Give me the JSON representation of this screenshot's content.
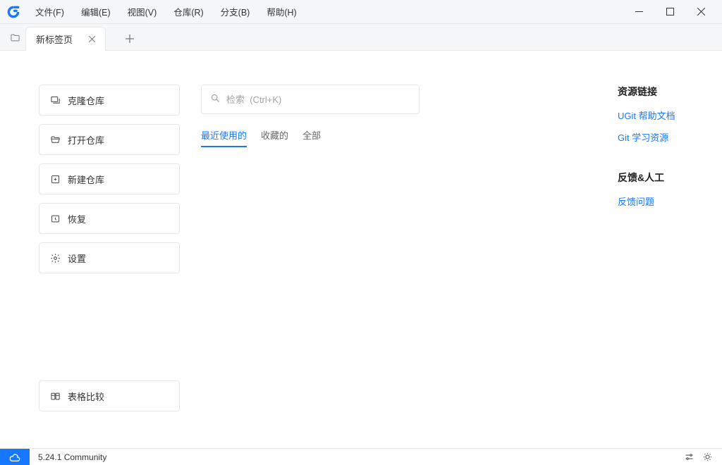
{
  "menubar": {
    "items": [
      "文件(F)",
      "编辑(E)",
      "视图(V)",
      "仓库(R)",
      "分支(B)",
      "帮助(H)"
    ]
  },
  "tabs": {
    "active": {
      "label": "新标签页"
    }
  },
  "actions": {
    "clone": "克隆仓库",
    "open": "打开仓库",
    "new": "新建仓库",
    "restore": "恢复",
    "settings": "设置",
    "compare": "表格比较"
  },
  "search": {
    "placeholder": "检索  (Ctrl+K)"
  },
  "filters": {
    "recent": "最近使用的",
    "favorites": "收藏的",
    "all": "全部"
  },
  "sidebar_right": {
    "resources_title": "资源链接",
    "help_docs": "UGit 帮助文档",
    "git_learn": "Git 学习资源",
    "feedback_title": "反馈&人工",
    "feedback_link": "反馈问题"
  },
  "statusbar": {
    "version": "5.24.1 Community"
  }
}
